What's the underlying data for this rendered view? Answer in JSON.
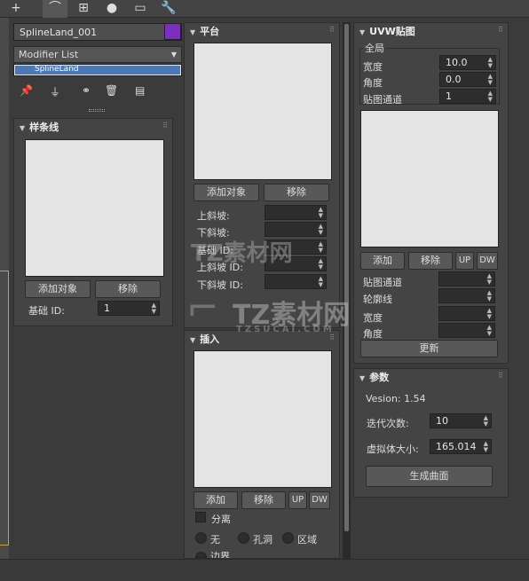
{
  "toolbar": {
    "tabs": [
      {
        "name": "create-tab",
        "glyph": "+"
      },
      {
        "name": "modify-tab",
        "glyph": "⌒"
      },
      {
        "name": "hierarchy-tab",
        "glyph": "⊞"
      },
      {
        "name": "motion-tab",
        "glyph": "●"
      },
      {
        "name": "display-tab",
        "glyph": "▭"
      },
      {
        "name": "utilities-tab",
        "glyph": "🔧"
      }
    ],
    "active_tab": "modify-tab"
  },
  "object": {
    "name": "SplineLand_001",
    "color": "#7b2fbe"
  },
  "modifier_list": {
    "label": "Modifier List",
    "stack_item": "SplineLand"
  },
  "spline_rollout": {
    "title": "样条线",
    "add_label": "添加对象",
    "remove_label": "移除",
    "base_id_label": "基础 ID:",
    "base_id_value": "1"
  },
  "platform_rollout": {
    "title": "平台",
    "add_label": "添加对象",
    "remove_label": "移除",
    "fields": [
      {
        "label": "上斜坡:",
        "value": ""
      },
      {
        "label": "下斜坡:",
        "value": ""
      },
      {
        "label": "基础 ID:",
        "value": ""
      },
      {
        "label": "上斜坡 ID:",
        "value": ""
      },
      {
        "label": "下斜坡 ID:",
        "value": ""
      }
    ]
  },
  "insert_rollout": {
    "title": "插入",
    "add_label": "添加",
    "remove_label": "移除",
    "up_label": "UP",
    "dw_label": "DW",
    "separate_label": "分离",
    "radio_none": "无",
    "radio_hole": "孔洞",
    "radio_area": "区域",
    "radio_extra": "边界"
  },
  "uvw_rollout": {
    "title": "UVW贴图",
    "group_label": "全局",
    "width_label": "宽度",
    "width_value": "10.0",
    "angle_label": "角度",
    "angle_value": "0.0",
    "channel_label": "贴图通道",
    "channel_value": "1",
    "add_label": "添加",
    "remove_label": "移除",
    "up_label": "UP",
    "dw_label": "DW",
    "list_fields": [
      {
        "label": "贴图通道",
        "value": ""
      },
      {
        "label": "轮廓线",
        "value": ""
      },
      {
        "label": "宽度",
        "value": ""
      },
      {
        "label": "角度",
        "value": ""
      }
    ],
    "update_label": "更新"
  },
  "params_rollout": {
    "title": "参数",
    "version_text": "Vesion: 1.54",
    "iterations_label": "迭代次数:",
    "iterations_value": "10",
    "virtual_size_label": "虚拟体大小:",
    "virtual_size_value": "165.014",
    "generate_label": "生成曲面"
  },
  "watermark": {
    "text1": "TZ素材网",
    "text2": "TZSUCAI.COM"
  }
}
